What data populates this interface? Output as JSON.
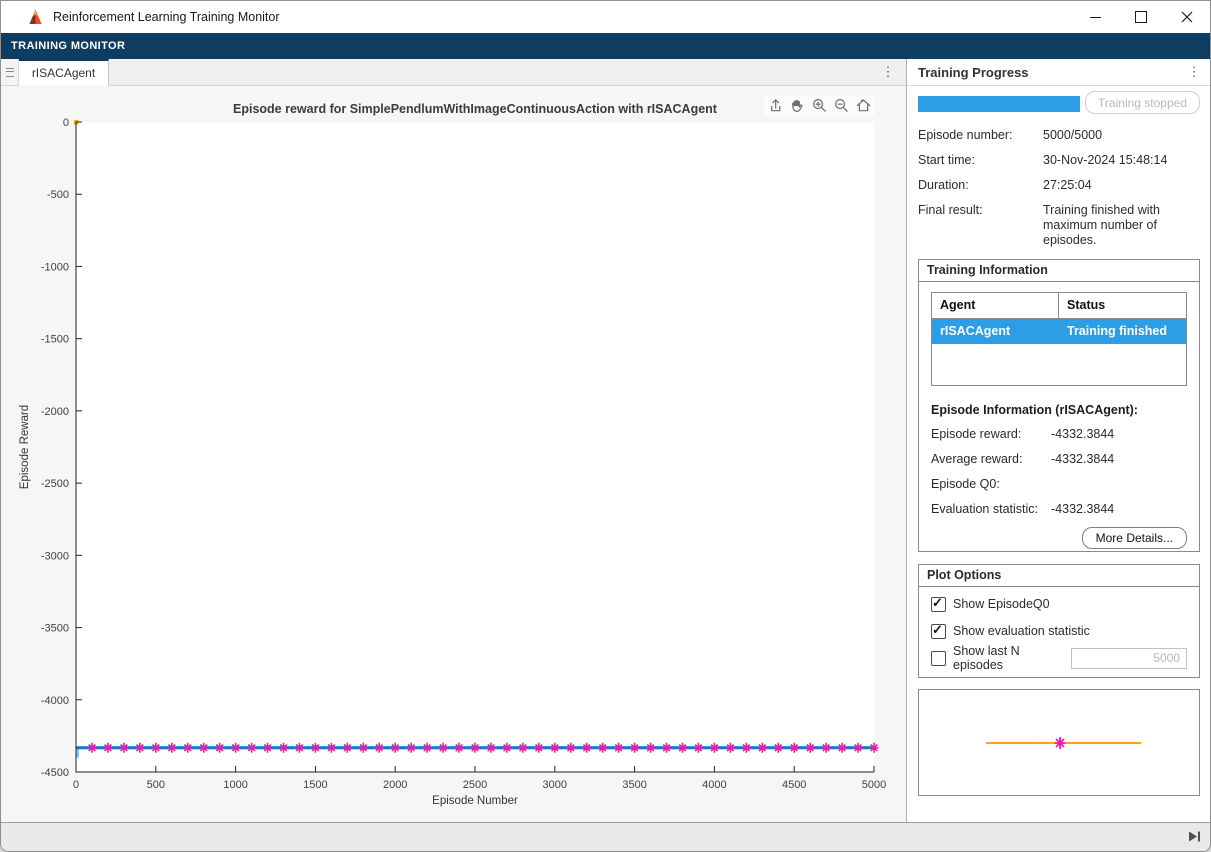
{
  "window": {
    "title": "Reinforcement Learning Training Monitor",
    "controls": [
      "minimize",
      "maximize",
      "close"
    ]
  },
  "ribbon": {
    "label": "TRAINING MONITOR"
  },
  "tab_bar": {
    "tabs": [
      {
        "label": "rISACAgent",
        "active": true
      }
    ]
  },
  "chart_data": {
    "type": "line",
    "title": "Episode reward for SimplePendlumWithImageContinuousAction with rISACAgent",
    "xlabel": "Episode Number",
    "ylabel": "Episode Reward",
    "xlim": [
      0,
      5000
    ],
    "ylim": [
      -4500,
      0
    ],
    "xticks": [
      0,
      500,
      1000,
      1500,
      2000,
      2500,
      3000,
      3500,
      4000,
      4500,
      5000
    ],
    "yticks": [
      0,
      -500,
      -1000,
      -1500,
      -2000,
      -2500,
      -3000,
      -3500,
      -4000,
      -4500
    ],
    "grid": false,
    "legend_position": "none",
    "series": [
      {
        "name": "Episode reward",
        "style": "line",
        "color": "#8cc1e8",
        "width": 3,
        "y_constant": -4332.3844,
        "x_range": [
          0,
          5000
        ],
        "initial_blip": {
          "x": 0,
          "y_min": -4400,
          "y_max": -4332.3844
        }
      },
      {
        "name": "Average reward",
        "style": "line",
        "color": "#1878c0",
        "width": 3,
        "y_constant": -4332.3844,
        "x_range": [
          0,
          5000
        ]
      },
      {
        "name": "EpisodeQ0",
        "style": "point",
        "color": "#f7a711",
        "points": [
          [
            0,
            0
          ]
        ]
      },
      {
        "name": "Evaluation statistic",
        "style": "asterisk",
        "color": "#e6219f",
        "y_constant": -4332.3844,
        "x_first": 100,
        "x_step": 100,
        "x_last": 5000
      }
    ],
    "toolbar_icons": [
      "export",
      "pan",
      "zoom-in",
      "zoom-out",
      "restore-view"
    ]
  },
  "training_progress": {
    "title": "Training Progress",
    "stop_button": "Training stopped",
    "progress_percent": 100,
    "rows": [
      {
        "label": "Episode number:",
        "value": "5000/5000"
      },
      {
        "label": "Start time:",
        "value": "30-Nov-2024 15:48:14"
      },
      {
        "label": "Duration:",
        "value": "27:25:04"
      },
      {
        "label": "Final result:",
        "value": "Training finished with maximum number of episodes."
      }
    ]
  },
  "training_information": {
    "title": "Training Information",
    "table": {
      "columns": [
        "Agent",
        "Status"
      ],
      "rows": [
        {
          "agent": "rISACAgent",
          "status": "Training finished",
          "selected": true
        }
      ]
    },
    "episode_info_title": "Episode Information (rISACAgent):",
    "rows": [
      {
        "label": "Episode reward:",
        "value": "-4332.3844"
      },
      {
        "label": "Average reward:",
        "value": "-4332.3844"
      },
      {
        "label": "Episode Q0:",
        "value": ""
      },
      {
        "label": "Evaluation statistic:",
        "value": "-4332.3844"
      }
    ],
    "more_details_button": "More Details..."
  },
  "plot_options": {
    "title": "Plot Options",
    "options": [
      {
        "label": "Show EpisodeQ0",
        "checked": true
      },
      {
        "label": "Show evaluation statistic",
        "checked": true
      },
      {
        "label": "Show last N episodes",
        "checked": false,
        "input_value": "5000",
        "input_disabled": true
      }
    ]
  },
  "preview": {
    "line_color": "#f7a711",
    "marker_color": "#e6219f"
  },
  "colors": {
    "ribbon_blue": "#0d3d63",
    "accent_blue": "#2b9ee5",
    "selection_blue": "#2b9ee5"
  }
}
